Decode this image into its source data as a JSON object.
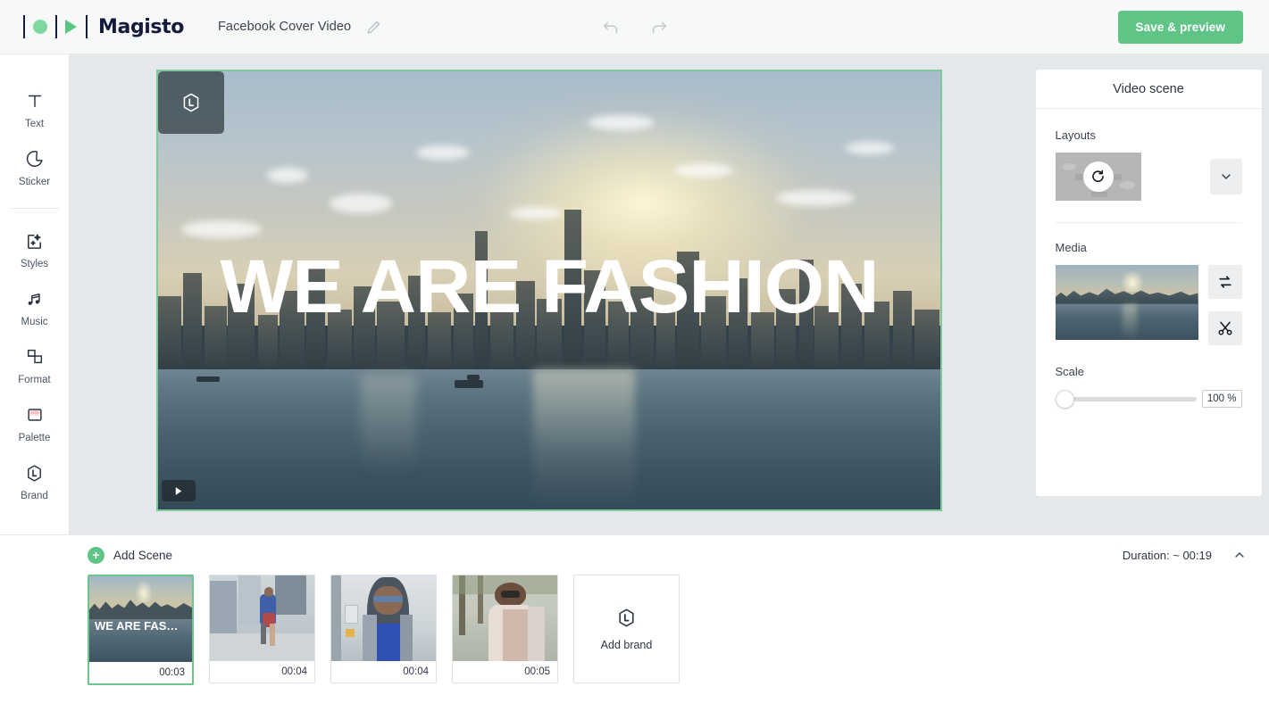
{
  "topbar": {
    "logo_text": "Magisto",
    "project_title": "Facebook Cover Video",
    "edit_icon": "pencil-icon",
    "undo_icon": "undo-arrow-icon",
    "redo_icon": "redo-arrow-icon",
    "save_label": "Save & preview",
    "accent_green": "#5fc486",
    "logo_navy": "#141a3c"
  },
  "sidebar": {
    "items": [
      {
        "label": "Text",
        "icon": "text-t-icon"
      },
      {
        "label": "Sticker",
        "icon": "sticker-icon"
      },
      {
        "label": "Styles",
        "icon": "styles-sparkle-icon"
      },
      {
        "label": "Music",
        "icon": "music-notes-icon"
      },
      {
        "label": "Format",
        "icon": "format-layout-icon"
      },
      {
        "label": "Palette",
        "icon": "palette-swatch-icon"
      },
      {
        "label": "Brand",
        "icon": "brand-hexagon-icon"
      }
    ]
  },
  "canvas": {
    "overlay_title": "WE ARE FASHION",
    "brand_placeholder_icon": "brand-hexagon-icon",
    "play_icon": "play-icon",
    "selection_border_color": "#7ec89b",
    "background_color": "#e4e8ea"
  },
  "panel": {
    "title": "Video scene",
    "layouts": {
      "label": "Layouts",
      "shuffle_icon": "refresh-rotate-icon",
      "expand_icon": "chevron-down-icon"
    },
    "media": {
      "label": "Media",
      "replace_icon": "swap-replace-icon",
      "trim_icon": "scissors-icon"
    },
    "scale": {
      "label": "Scale",
      "value": "100 %",
      "percent": 0
    }
  },
  "timeline": {
    "add_scene_label": "Add Scene",
    "add_scene_icon": "plus-circle-icon",
    "duration_label": "Duration: ~ 00:19",
    "collapse_icon": "chevron-up-icon",
    "scenes": [
      {
        "duration": "00:03",
        "caption": "WE ARE FAS…",
        "selected": true
      },
      {
        "duration": "00:04",
        "caption": "",
        "selected": false
      },
      {
        "duration": "00:04",
        "caption": "",
        "selected": false
      },
      {
        "duration": "00:05",
        "caption": "",
        "selected": false
      }
    ],
    "add_brand": {
      "label": "Add brand",
      "icon": "brand-hexagon-icon"
    }
  }
}
